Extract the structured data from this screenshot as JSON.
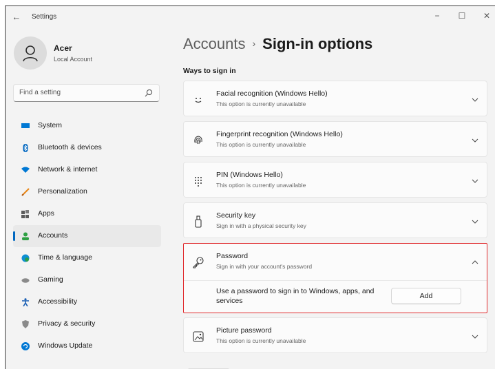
{
  "window": {
    "title": "Settings",
    "back_icon": "arrow-left-icon",
    "controls": {
      "minimize": "−",
      "maximize": "☐",
      "close": "✕"
    }
  },
  "profile": {
    "name": "Acer",
    "subtitle": "Local Account",
    "icon": "person-icon"
  },
  "search": {
    "placeholder": "Find a setting",
    "icon": "search-icon"
  },
  "sidebar": {
    "items": [
      {
        "label": "System",
        "icon": "monitor-icon",
        "color": "#0078d4"
      },
      {
        "label": "Bluetooth & devices",
        "icon": "bluetooth-icon",
        "color": "#0067c0"
      },
      {
        "label": "Network & internet",
        "icon": "wifi-icon",
        "color": "#0078d4"
      },
      {
        "label": "Personalization",
        "icon": "brush-icon",
        "color": "#e8891d"
      },
      {
        "label": "Apps",
        "icon": "apps-icon",
        "color": "#5a5a5a"
      },
      {
        "label": "Accounts",
        "icon": "accounts-icon",
        "color": "#2ea043",
        "active": true
      },
      {
        "label": "Time & language",
        "icon": "globe-clock-icon",
        "color": "#0e8fd3"
      },
      {
        "label": "Gaming",
        "icon": "gamepad-icon",
        "color": "#7a7a7a"
      },
      {
        "label": "Accessibility",
        "icon": "accessibility-icon",
        "color": "#1a5fb4"
      },
      {
        "label": "Privacy & security",
        "icon": "shield-icon",
        "color": "#7a7a7a"
      },
      {
        "label": "Windows Update",
        "icon": "update-icon",
        "color": "#0078d4"
      }
    ]
  },
  "breadcrumb": {
    "parent": "Accounts",
    "separator": "›",
    "current": "Sign-in options"
  },
  "section_title": "Ways to sign in",
  "options": [
    {
      "title": "Facial recognition (Windows Hello)",
      "subtitle": "This option is currently unavailable",
      "icon": "face-icon"
    },
    {
      "title": "Fingerprint recognition (Windows Hello)",
      "subtitle": "This option is currently unavailable",
      "icon": "fingerprint-icon"
    },
    {
      "title": "PIN (Windows Hello)",
      "subtitle": "This option is currently unavailable",
      "icon": "keypad-icon"
    },
    {
      "title": "Security key",
      "subtitle": "Sign in with a physical security key",
      "icon": "usb-key-icon"
    },
    {
      "title": "Password",
      "subtitle": "Sign in with your account's password",
      "icon": "key-icon",
      "expanded": true,
      "description": "Use a password to sign in to Windows, apps, and services",
      "button": "Add"
    },
    {
      "title": "Picture password",
      "subtitle": "This option is currently unavailable",
      "icon": "picture-icon"
    }
  ],
  "colors": {
    "accent": "#0067c0",
    "highlight_border": "#e0272a",
    "background": "#f3f3f3"
  }
}
